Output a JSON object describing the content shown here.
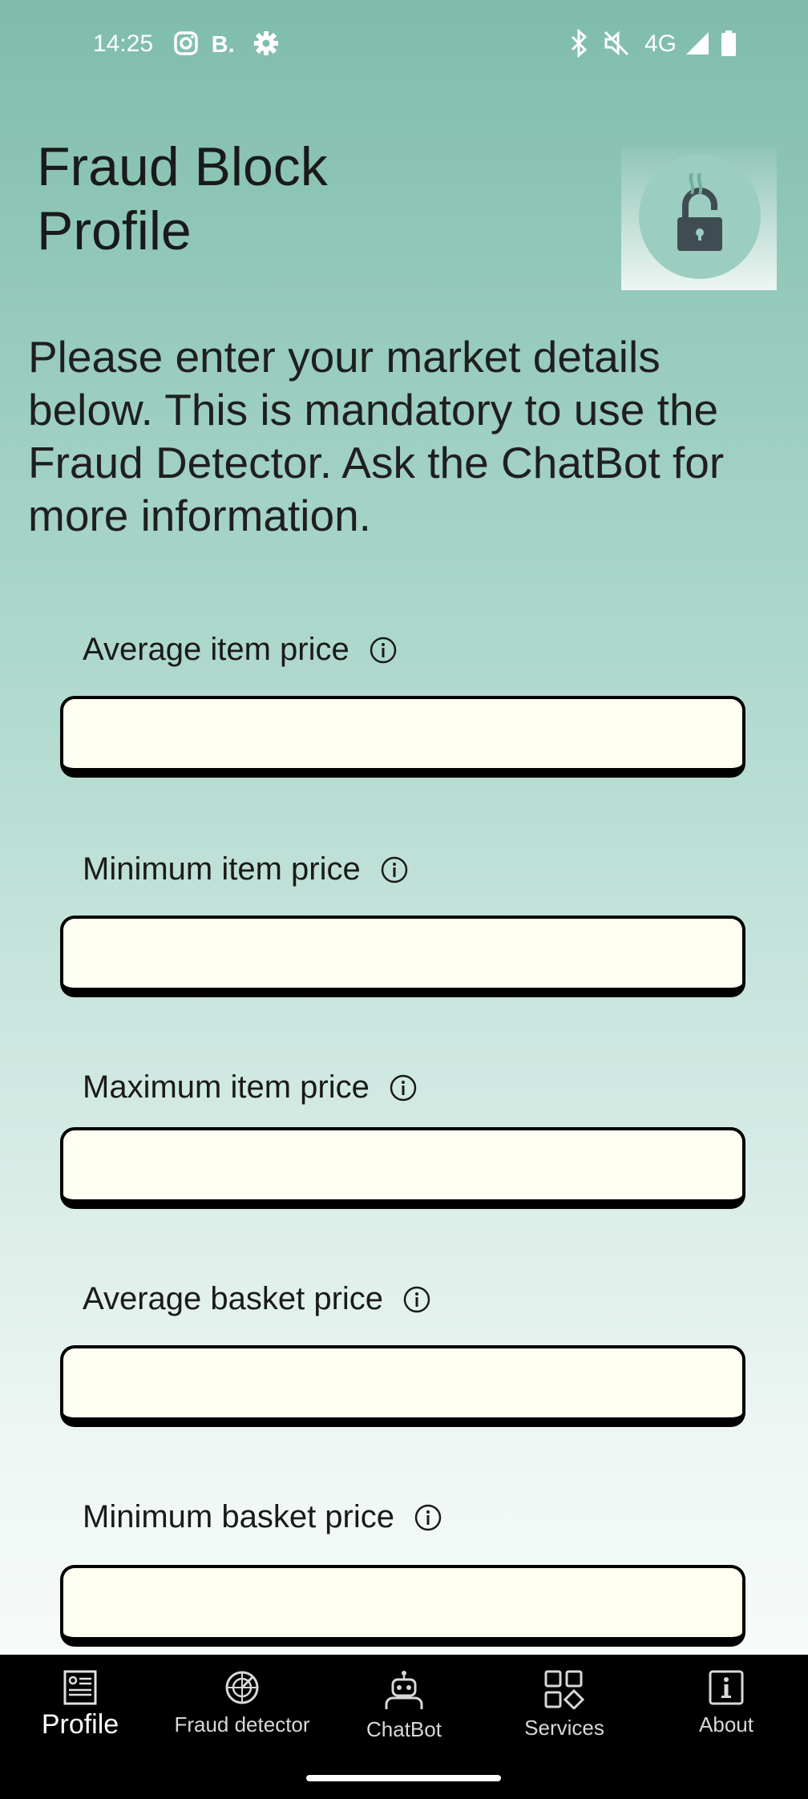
{
  "status_bar": {
    "time": "14:25",
    "network": "4G",
    "icons": [
      "instagram-icon",
      "booking-icon",
      "gear-icon",
      "bluetooth-icon",
      "mute-icon",
      "signal-icon",
      "battery-icon"
    ]
  },
  "header": {
    "title": "Fraud Block\nProfile",
    "logo_icon": "lock-icon"
  },
  "intro_text": "Please enter your market details below. This is mandatory to use the Fraud Detector. Ask the ChatBot for more information.",
  "fields": [
    {
      "label": "Average item price",
      "value": ""
    },
    {
      "label": "Minimum item price",
      "value": ""
    },
    {
      "label": "Maximum item price",
      "value": ""
    },
    {
      "label": "Average basket price",
      "value": ""
    },
    {
      "label": "Minimum basket price",
      "value": ""
    }
  ],
  "nav": {
    "items": [
      {
        "label": "Profile",
        "icon": "profile-icon",
        "active": true
      },
      {
        "label": "Fraud detector",
        "icon": "radar-icon",
        "active": false
      },
      {
        "label": "ChatBot",
        "icon": "robot-icon",
        "active": false
      },
      {
        "label": "Services",
        "icon": "grid-icon",
        "active": false
      },
      {
        "label": "About",
        "icon": "info-icon",
        "active": false
      }
    ]
  },
  "colors": {
    "input_bg": "#fefff0",
    "nav_bg": "#000000",
    "accent": "#7fbcab"
  }
}
